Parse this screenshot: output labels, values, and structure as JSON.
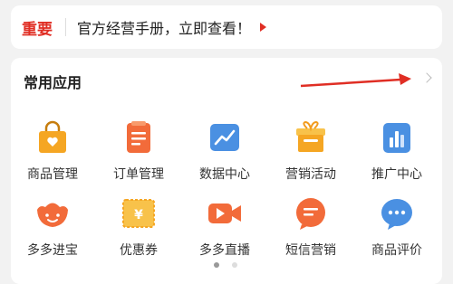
{
  "notice": {
    "tag": "重要",
    "text": "官方经营手册，立即查看！"
  },
  "section": {
    "title": "常用应用"
  },
  "apps": [
    {
      "label": "商品管理",
      "icon": "shopping-bag-icon"
    },
    {
      "label": "订单管理",
      "icon": "order-list-icon"
    },
    {
      "label": "数据中心",
      "icon": "chart-line-icon"
    },
    {
      "label": "营销活动",
      "icon": "gift-box-icon"
    },
    {
      "label": "推广中心",
      "icon": "bar-chart-icon"
    },
    {
      "label": "多多进宝",
      "icon": "treasure-icon"
    },
    {
      "label": "优惠券",
      "icon": "coupon-icon"
    },
    {
      "label": "多多直播",
      "icon": "live-video-icon"
    },
    {
      "label": "短信营销",
      "icon": "sms-icon"
    },
    {
      "label": "商品评价",
      "icon": "review-chat-icon"
    }
  ],
  "colors": {
    "brand": "#e02e24",
    "orange": "#f5a623",
    "blue": "#4a90e2"
  }
}
